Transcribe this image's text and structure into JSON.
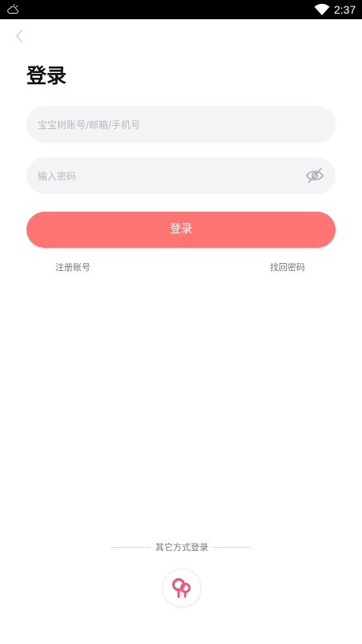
{
  "status_bar": {
    "time": "2:37",
    "left_icon": "weather-cloud-sun-icon",
    "wifi_icon": "wifi-icon"
  },
  "nav": {
    "back_icon": "chevron-left-icon"
  },
  "page": {
    "title": "登录"
  },
  "form": {
    "account_placeholder": "宝宝树账号/邮箱/手机号",
    "password_placeholder": "输入密码",
    "password_toggle_icon": "eye-hidden-icon",
    "login_label": "登录"
  },
  "links": {
    "register": "注册账号",
    "forgot_password": "找回密码"
  },
  "other_login": {
    "label": "其它方式登录",
    "provider_icon": "babytree-logo-icon"
  },
  "colors": {
    "accent": "#ff7574",
    "field_bg": "#f4f4f7",
    "logo": "#e9597a"
  }
}
